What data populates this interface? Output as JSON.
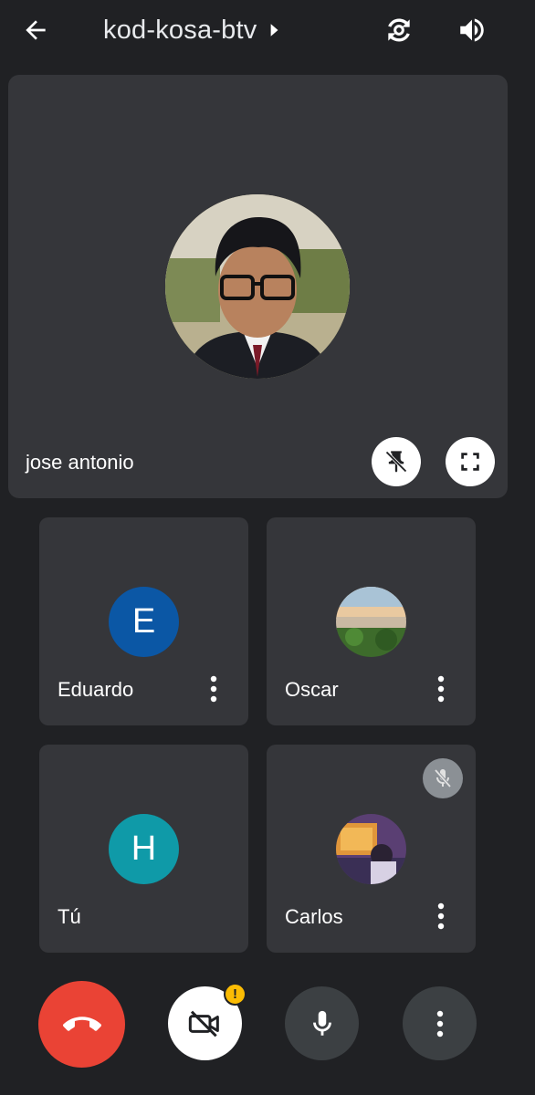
{
  "header": {
    "back_icon": "arrow-left-icon",
    "meeting_code": "kod-kosa-btv",
    "switch_camera_icon": "switch-camera-icon",
    "speaker_icon": "volume-icon"
  },
  "main_participant": {
    "name": "jose antonio",
    "unpin_icon": "unpin-icon",
    "fullscreen_icon": "fullscreen-icon"
  },
  "participants": [
    {
      "name": "Eduardo",
      "initial": "E",
      "avatar_color": "#0b57a5",
      "has_menu": true
    },
    {
      "name": "Oscar",
      "initial": "",
      "avatar_type": "photo",
      "has_menu": true
    },
    {
      "name": "Tú",
      "initial": "H",
      "avatar_color": "#0f9aa8",
      "has_menu": false
    },
    {
      "name": "Carlos",
      "initial": "",
      "avatar_type": "photo",
      "muted": true,
      "has_menu": true
    }
  ],
  "controls": {
    "end_call_icon": "end-call-icon",
    "camera_off_icon": "camera-off-icon",
    "camera_warning": "!",
    "mic_icon": "microphone-icon",
    "more_icon": "more-vert-icon"
  },
  "colors": {
    "background": "#202124",
    "tile": "#35363a",
    "end_call": "#ea4335",
    "warning": "#fbbc04"
  }
}
